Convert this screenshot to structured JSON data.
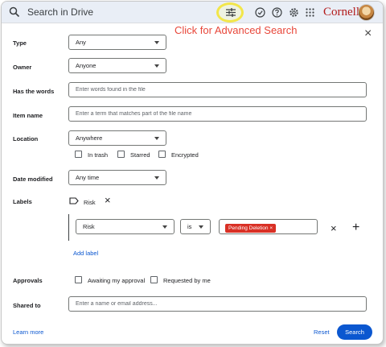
{
  "search_bar": {
    "label": "Search in Drive"
  },
  "toolbar": {
    "icons": [
      "tune-icon",
      "ready-for-offline-icon",
      "help-icon",
      "settings-icon",
      "apps-grid-icon"
    ]
  },
  "brand": {
    "name": "Cornell",
    "color": "#b31b1b"
  },
  "annotation": {
    "text": "Click for Advanced Search",
    "color": "#e8473a"
  },
  "close_label": "×",
  "form": {
    "type": {
      "label": "Type",
      "value": "Any"
    },
    "owner": {
      "label": "Owner",
      "value": "Anyone"
    },
    "has_words": {
      "label": "Has the words",
      "placeholder": "Enter words found in the file"
    },
    "item_name": {
      "label": "Item name",
      "placeholder": "Enter a term that matches part of the file name"
    },
    "location": {
      "label": "Location",
      "value": "Anywhere",
      "checkboxes": [
        "In trash",
        "Starred",
        "Encrypted"
      ]
    },
    "date_modified": {
      "label": "Date modified",
      "value": "Any time"
    },
    "labels": {
      "label": "Labels",
      "label_name": "Risk",
      "remove": "×",
      "field": "Risk",
      "operator": "is",
      "value_pill": "Pending Deletion",
      "pill_remove": "×",
      "row_remove": "×",
      "row_add": "+",
      "add_label": "Add label"
    },
    "approvals": {
      "label": "Approvals",
      "checkboxes": [
        "Awaiting my approval",
        "Requested by me"
      ]
    },
    "shared_to": {
      "label": "Shared to",
      "placeholder": "Enter a name or email address..."
    }
  },
  "footer": {
    "learn_more": "Learn more",
    "reset": "Reset",
    "search": "Search"
  },
  "colors": {
    "accent": "#0b57d0",
    "pill": "#d93025",
    "topbar": "#e9eef6"
  }
}
